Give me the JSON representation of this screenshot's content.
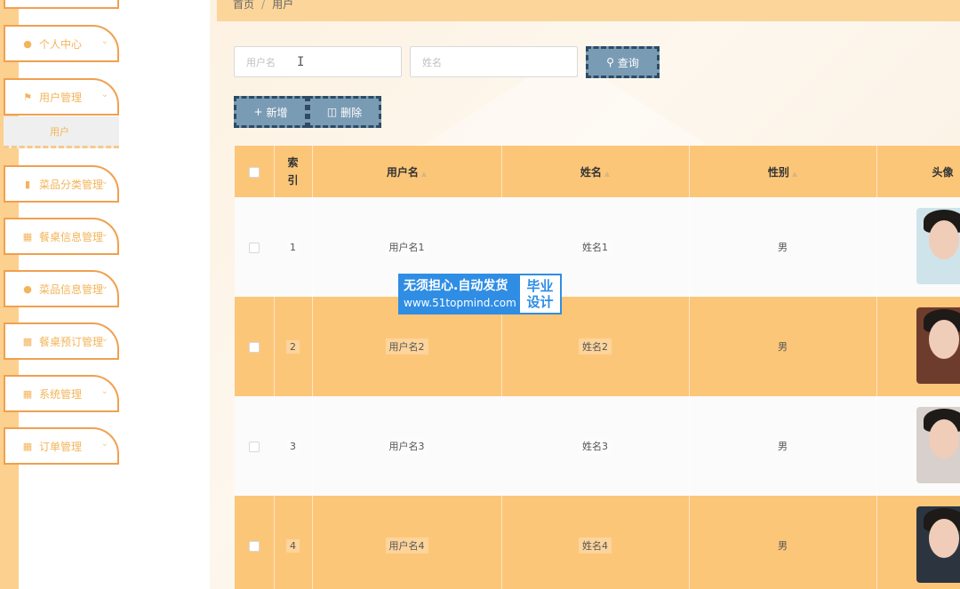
{
  "breadcrumb": {
    "home": "首页",
    "separator": "/",
    "current": "用户"
  },
  "sidebar": {
    "items": [
      {
        "label": "个人中心",
        "icon": "user-icon"
      },
      {
        "label": "用户管理",
        "icon": "flag-icon"
      },
      {
        "label": "菜品分类管理",
        "icon": "chat-icon"
      },
      {
        "label": "餐桌信息管理",
        "icon": "grid-icon"
      },
      {
        "label": "菜品信息管理",
        "icon": "bulb-icon"
      },
      {
        "label": "餐桌预订管理",
        "icon": "bar-chart-icon"
      },
      {
        "label": "系统管理",
        "icon": "apps-icon"
      },
      {
        "label": "订单管理",
        "icon": "apps-icon"
      }
    ],
    "submenu": {
      "label": "用户"
    }
  },
  "search": {
    "username_placeholder": "用户名",
    "name_placeholder": "姓名",
    "query_label": "查询"
  },
  "actions": {
    "add_label": "新增",
    "delete_label": "删除"
  },
  "table": {
    "headers": {
      "index": "索引",
      "username": "用户名",
      "name": "姓名",
      "gender": "性别",
      "avatar": "头像"
    },
    "rows": [
      {
        "index": "1",
        "username": "用户名1",
        "name": "姓名1",
        "gender": "男"
      },
      {
        "index": "2",
        "username": "用户名2",
        "name": "姓名2",
        "gender": "男"
      },
      {
        "index": "3",
        "username": "用户名3",
        "name": "姓名3",
        "gender": "男"
      },
      {
        "index": "4",
        "username": "用户名4",
        "name": "姓名4",
        "gender": "男"
      }
    ]
  },
  "watermark": {
    "line1": "无须担心.自动发货",
    "line2": "www.51topmind.com",
    "badge_line1": "毕业",
    "badge_line2": "设计"
  },
  "colors": {
    "accent": "#fcc679",
    "sidebar_border": "#f0a050",
    "button": "#7a9bb4",
    "button_border": "#2e4b66",
    "watermark_blue": "#2f8de4"
  }
}
